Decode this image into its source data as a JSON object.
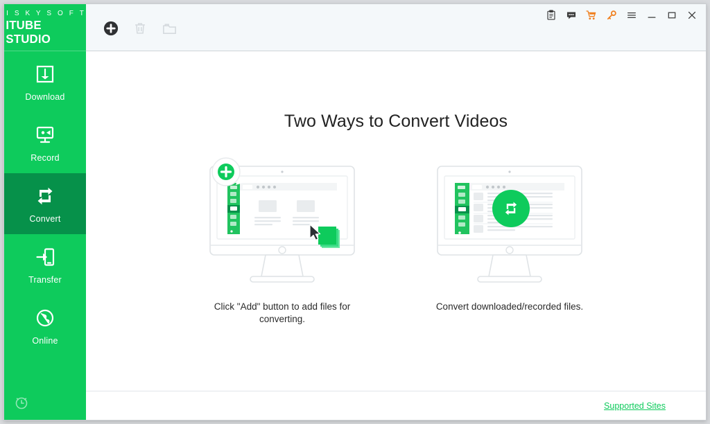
{
  "app": {
    "logo_top": "I S K Y S O F T",
    "logo_main": "ITUBE STUDIO",
    "accent_green": "#0ECB5C",
    "accent_green_dark": "#06914A",
    "accent_orange": "#F08020"
  },
  "sidebar": {
    "items": [
      {
        "label": "Download",
        "icon": "download-icon",
        "active": false
      },
      {
        "label": "Record",
        "icon": "record-camera-icon",
        "active": false
      },
      {
        "label": "Convert",
        "icon": "convert-refresh-icon",
        "active": true
      },
      {
        "label": "Transfer",
        "icon": "transfer-device-icon",
        "active": false
      },
      {
        "label": "Online",
        "icon": "online-globe-icon",
        "active": false
      }
    ],
    "bottom_icon": "clock-icon"
  },
  "toolbar": {
    "buttons": [
      {
        "name": "add-button",
        "icon": "plus-circle-icon",
        "enabled": true
      },
      {
        "name": "delete-button",
        "icon": "trash-icon",
        "enabled": false
      },
      {
        "name": "open-folder-button",
        "icon": "folder-icon",
        "enabled": false
      }
    ]
  },
  "window_controls": [
    {
      "name": "notes-icon",
      "icon": "clipboard-icon",
      "color": "#3b3b3b"
    },
    {
      "name": "feedback-icon",
      "icon": "speech-bubble-icon",
      "color": "#3b3b3b"
    },
    {
      "name": "buy-icon",
      "icon": "shopping-cart-icon",
      "color": "#F08020"
    },
    {
      "name": "register-icon",
      "icon": "key-icon",
      "color": "#F08020"
    },
    {
      "name": "menu-icon",
      "icon": "hamburger-menu-icon",
      "color": "#3b3b3b"
    },
    {
      "name": "minimize-icon",
      "icon": "minimize-icon",
      "color": "#3b3b3b"
    },
    {
      "name": "maximize-icon",
      "icon": "maximize-icon",
      "color": "#3b3b3b"
    },
    {
      "name": "close-icon",
      "icon": "close-icon",
      "color": "#3b3b3b"
    }
  ],
  "main": {
    "title": "Two Ways to Convert Videos",
    "cards": [
      {
        "art": "monitor-with-add-badge",
        "caption": "Click \"Add\" button to add files for converting."
      },
      {
        "art": "monitor-with-convert-badge",
        "caption": "Convert downloaded/recorded files."
      }
    ]
  },
  "footer": {
    "supported_sites_label": "Supported Sites"
  }
}
